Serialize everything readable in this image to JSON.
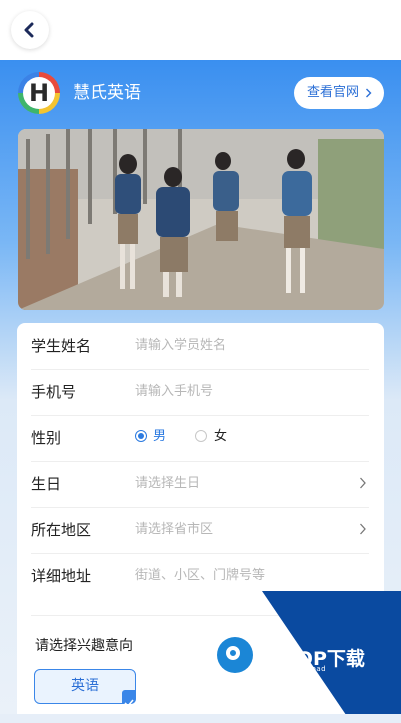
{
  "header": {
    "back_icon": "chevron-left-icon"
  },
  "brand": {
    "logo_letter": "H",
    "name": "慧氏英语",
    "official_site_label": "查看官网"
  },
  "form": {
    "fields": [
      {
        "label": "学生姓名",
        "placeholder": "请输入学员姓名"
      },
      {
        "label": "手机号",
        "placeholder": "请输入手机号"
      },
      {
        "label": "性别",
        "options": [
          "男",
          "女"
        ],
        "selected": "男"
      },
      {
        "label": "生日",
        "placeholder": "请选择生日"
      },
      {
        "label": "所在地区",
        "placeholder": "请选择省市区"
      },
      {
        "label": "详细地址",
        "placeholder": "街道、小区、门牌号等"
      }
    ],
    "interest_title": "请选择兴趣意向",
    "interests": [
      {
        "label": "英语",
        "checked": true
      }
    ]
  },
  "watermark": {
    "title": "PCPOP下载",
    "subtitle": "PCPOP Download"
  },
  "colors": {
    "accent": "#2b7ae0",
    "banner_blue": "#3a8ff0"
  }
}
